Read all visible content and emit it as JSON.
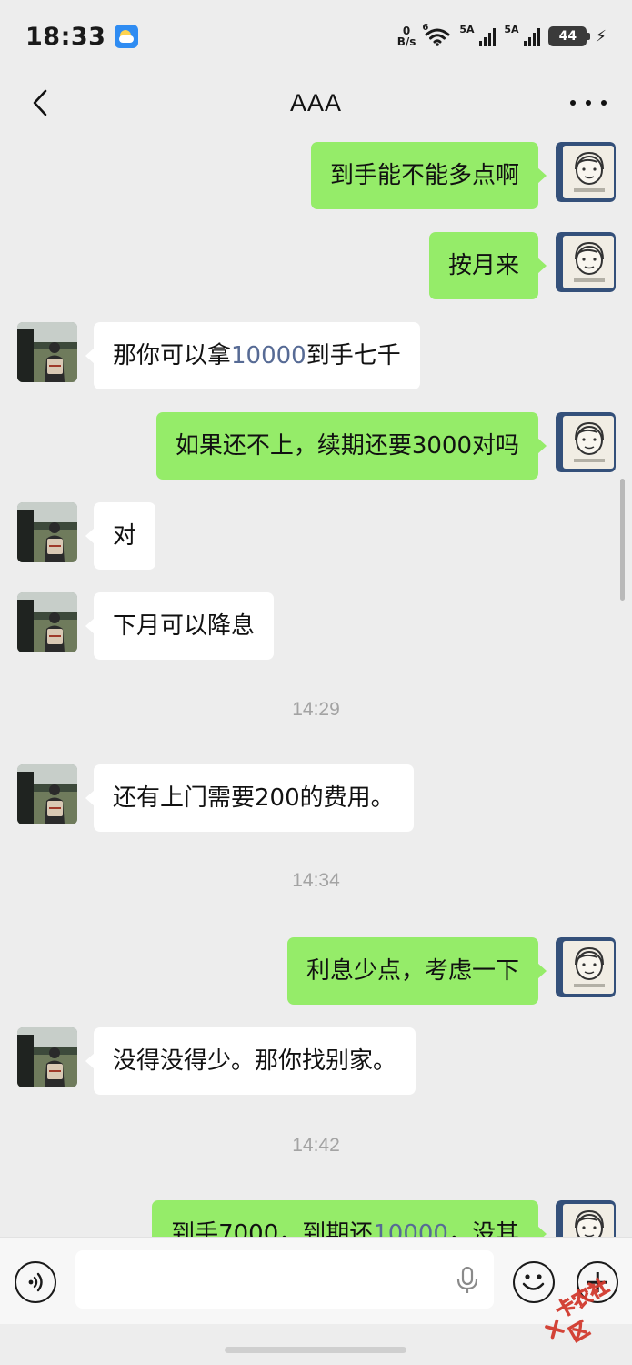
{
  "status_bar": {
    "time": "18:33",
    "net_speed_value": "0",
    "net_speed_unit": "B/s",
    "wifi_label": "6",
    "signal1_label": "5A",
    "signal2_label": "5A",
    "battery": "44"
  },
  "header": {
    "title": "AAA"
  },
  "messages": [
    {
      "side": "me",
      "text": "到手能不能多点啊"
    },
    {
      "side": "me",
      "text": "按月来"
    },
    {
      "side": "them",
      "parts": [
        "那你可以拿",
        "10000",
        "到手七千"
      ]
    },
    {
      "side": "me",
      "text": "如果还不上，续期还要3000对吗"
    },
    {
      "side": "them",
      "text": "对"
    },
    {
      "side": "them",
      "text": "下月可以降息"
    },
    {
      "type": "time",
      "text": "14:29"
    },
    {
      "side": "them",
      "text": "还有上门需要200的费用。"
    },
    {
      "type": "time",
      "text": "14:34"
    },
    {
      "side": "me",
      "text": "利息少点，考虑一下"
    },
    {
      "side": "them",
      "text": "没得没得少。那你找别家。"
    },
    {
      "type": "time",
      "text": "14:42"
    },
    {
      "side": "me",
      "parts": [
        "到手7000，到期还",
        "10000",
        "，没其"
      ]
    }
  ],
  "input_bar": {
    "placeholder": ""
  },
  "watermark": {
    "text": "卡农社区"
  },
  "colors": {
    "my_bubble": "#95ec69",
    "their_bubble": "#ffffff",
    "link_number": "#576b95",
    "background": "#ededed"
  }
}
